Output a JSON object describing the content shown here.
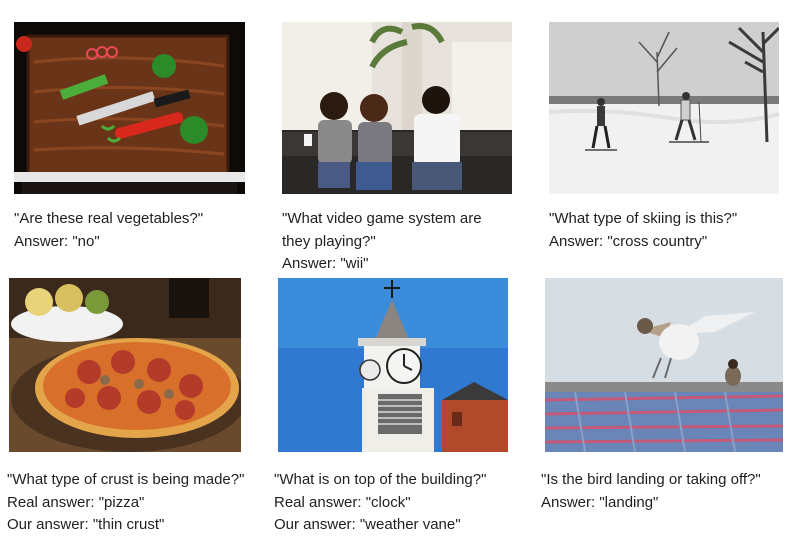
{
  "items": [
    {
      "photo_subject": "cake decorated like a cutting board with vegetables",
      "question": "\"Are these real vegetables?\"",
      "answer": "Answer: \"no\""
    },
    {
      "photo_subject": "three people sitting on a couch playing a video game",
      "question_l1": "\"What video game system are",
      "question_l2": "they playing?\"",
      "answer": "Answer: \"wii\""
    },
    {
      "photo_subject": "two people cross-country skiing on snow",
      "question": "\"What type of skiing is this?\"",
      "answer": "Answer: \"cross country\""
    },
    {
      "photo_subject": "pizza on a wooden board",
      "question": "\"What type of crust is being made?\"",
      "real": "Real answer: \"pizza\"",
      "ours": "Our answer: \"thin crust\""
    },
    {
      "photo_subject": "clock tower with weather vane against blue sky",
      "question": "\"What is on top of the building?\"",
      "real": "Real answer: \"clock\"",
      "ours": "Our answer: \"weather vane\""
    },
    {
      "photo_subject": "bird with spread wings above a blanket",
      "question": "\"Is the bird landing or taking off?\"",
      "answer": "Answer: \"landing\""
    }
  ]
}
